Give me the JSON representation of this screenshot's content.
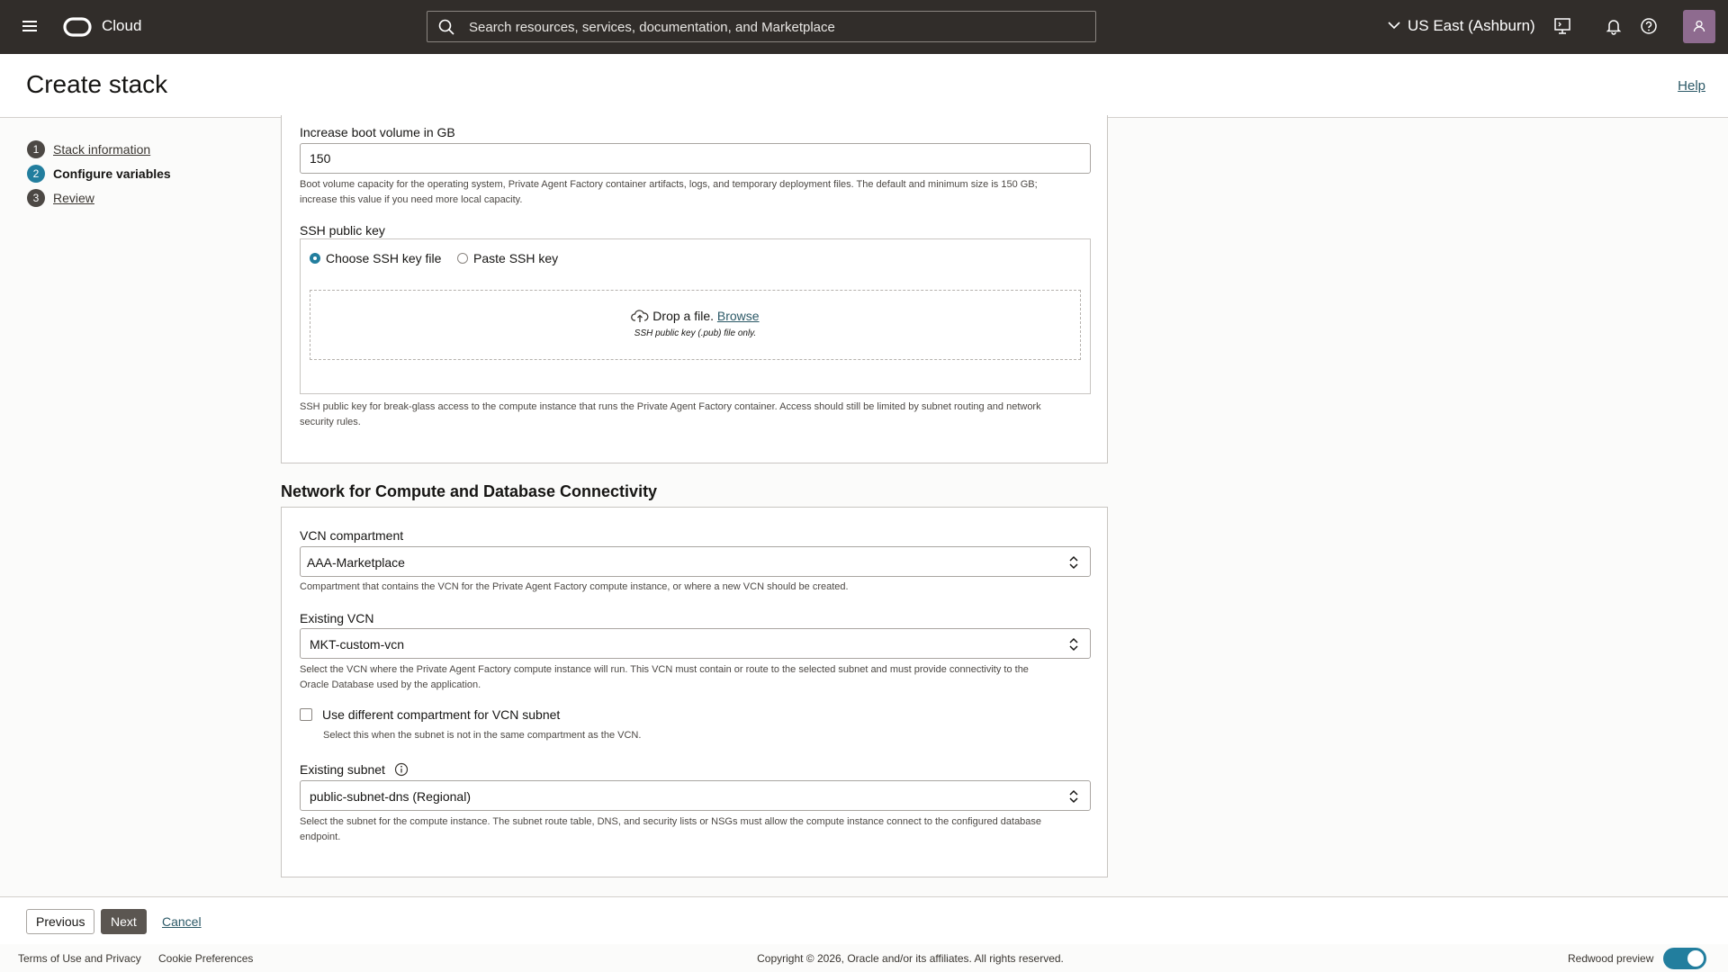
{
  "topbar": {
    "brand": "Cloud",
    "search_placeholder": "Search resources, services, documentation, and Marketplace",
    "region": "US East (Ashburn)"
  },
  "page": {
    "title": "Create stack",
    "help": "Help"
  },
  "steps": [
    {
      "num": "1",
      "label": "Stack information"
    },
    {
      "num": "2",
      "label": "Configure variables"
    },
    {
      "num": "3",
      "label": "Review"
    }
  ],
  "boot": {
    "label": "Increase boot volume in GB",
    "value": "150",
    "hint1": "Boot volume capacity for the operating system, Private Agent Factory container artifacts, logs, and temporary deployment files. The default and minimum size is 150 GB;",
    "hint2": "increase this value if you need more local capacity."
  },
  "ssh": {
    "label": "SSH public key",
    "option_file": "Choose SSH key file",
    "option_paste": "Paste SSH key",
    "drop_text": "Drop a file.",
    "browse": "Browse",
    "drop_sub": "SSH public key (.pub) file only.",
    "hint1": "SSH public key for break-glass access to the compute instance that runs the Private Agent Factory container. Access should still be limited by subnet routing and network",
    "hint2": "security rules."
  },
  "network": {
    "heading": "Network for Compute and Database Connectivity",
    "vcn_compartment_label": "VCN compartment",
    "vcn_compartment_value": "AAA-Marketplace",
    "vcn_compartment_hint": "Compartment that contains the VCN for the Private Agent Factory compute instance, or where a new VCN should be created.",
    "vcn_label": "Existing VCN",
    "vcn_value": "MKT-custom-vcn",
    "vcn_hint1": "Select the VCN where the Private Agent Factory compute instance will run. This VCN must contain or route to the selected subnet and must provide connectivity to the",
    "vcn_hint2": "Oracle Database used by the application.",
    "diff_compartment_label": "Use different compartment for VCN subnet",
    "diff_compartment_hint": "Select this when the subnet is not in the same compartment as the VCN.",
    "subnet_label": "Existing subnet",
    "subnet_value": "public-subnet-dns (Regional)",
    "subnet_hint1": "Select the subnet for the compute instance. The subnet route table, DNS, and security lists or NSGs must allow the compute instance connect to the configured database",
    "subnet_hint2": "endpoint."
  },
  "actions": {
    "previous": "Previous",
    "next": "Next",
    "cancel": "Cancel"
  },
  "footer": {
    "terms": "Terms of Use and Privacy",
    "cookies": "Cookie Preferences",
    "copyright": "Copyright © 2026, Oracle and/or its affiliates. All rights reserved.",
    "redwood": "Redwood preview"
  }
}
